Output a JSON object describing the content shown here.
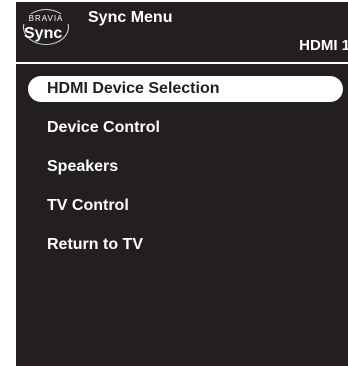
{
  "logo": {
    "brand_small": "BRAVIA",
    "brand_large": "Sync"
  },
  "header": {
    "title": "Sync Menu",
    "input": "HDMI 1"
  },
  "menu": {
    "selected_index": 0,
    "items": [
      {
        "label": "HDMI Device Selection"
      },
      {
        "label": "Device Control"
      },
      {
        "label": "Speakers"
      },
      {
        "label": "TV Control"
      },
      {
        "label": "Return to TV"
      }
    ]
  },
  "colors": {
    "background": "#231f20",
    "text": "#ffffff",
    "highlight": "#ffffff"
  }
}
